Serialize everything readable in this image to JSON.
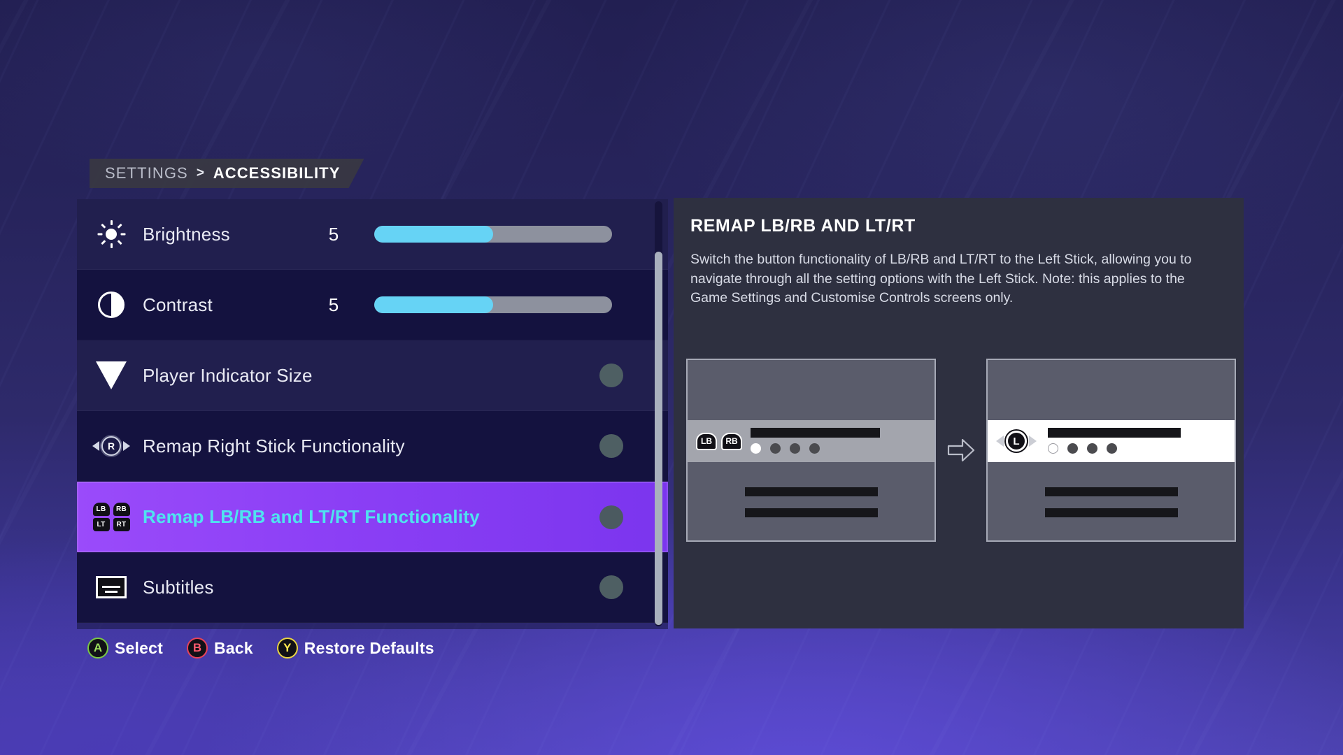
{
  "breadcrumb": {
    "root": "SETTINGS",
    "separator": ">",
    "current": "ACCESSIBILITY"
  },
  "settings": {
    "rows": [
      {
        "label": "Brightness",
        "icon": "brightness-sun-icon",
        "control": "slider",
        "value": "5",
        "fill_percent": 50
      },
      {
        "label": "Contrast",
        "icon": "contrast-circle-icon",
        "control": "slider",
        "value": "5",
        "fill_percent": 50
      },
      {
        "label": "Player Indicator Size",
        "icon": "triangle-indicator-icon",
        "control": "toggle"
      },
      {
        "label": "Remap Right Stick Functionality",
        "icon": "right-stick-icon",
        "control": "toggle"
      },
      {
        "label": "Remap LB/RB and LT/RT Functionality",
        "icon": "bumper-trigger-icon",
        "control": "toggle",
        "selected": true
      },
      {
        "label": "Subtitles",
        "icon": "subtitles-icon",
        "control": "toggle"
      }
    ]
  },
  "detail": {
    "title": "REMAP LB/RB AND LT/RT",
    "description": "Switch the button functionality of LB/RB and LT/RT to the Left Stick, allowing you to navigate through all the setting options with the Left Stick. Note: this applies to the Game Settings and Customise Controls screens only.",
    "preview_before": {
      "bumper_left": "LB",
      "bumper_right": "RB",
      "dots_total": 4,
      "dot_active_index": 0
    },
    "preview_after": {
      "stick": "L",
      "dots_total": 4,
      "dot_active_index": 0
    },
    "arrow_icon": "arrow-right-icon"
  },
  "hints": [
    {
      "button": "A",
      "label": "Select",
      "color": "#9ee05e"
    },
    {
      "button": "B",
      "label": "Back",
      "color": "#ff5a6e"
    },
    {
      "button": "Y",
      "label": "Restore Defaults",
      "color": "#ffe84f"
    }
  ],
  "colors": {
    "selected_row": "#8b3ff5",
    "selected_text": "#4fe3ef",
    "slider_fill": "#66d3f5",
    "slider_track": "#8d919e",
    "panel_bg": "#2e3040"
  }
}
